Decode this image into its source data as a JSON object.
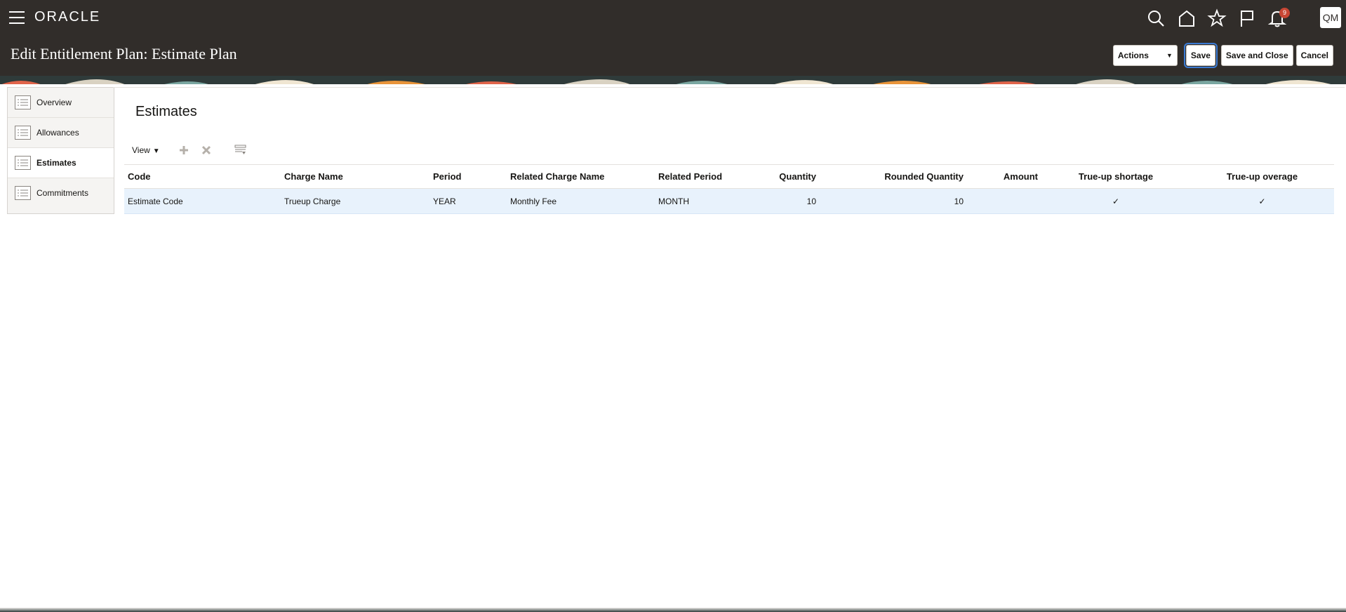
{
  "header": {
    "brand": "ORACLE",
    "notifications_count": "9",
    "user_initials": "QM",
    "page_title": "Edit Entitlement Plan: Estimate Plan",
    "actions_label": "Actions",
    "save_label": "Save",
    "save_close_label": "Save and Close",
    "cancel_label": "Cancel"
  },
  "sidebar": {
    "items": [
      {
        "label": "Overview",
        "active": false
      },
      {
        "label": "Allowances",
        "active": false
      },
      {
        "label": "Estimates",
        "active": true
      },
      {
        "label": "Commitments",
        "active": false
      }
    ]
  },
  "main": {
    "section_title": "Estimates",
    "toolbar": {
      "view_label": "View"
    },
    "table": {
      "columns": [
        "Code",
        "Charge Name",
        "Period",
        "Related Charge Name",
        "Related Period",
        "Quantity",
        "Rounded Quantity",
        "Amount",
        "True-up shortage",
        "True-up overage"
      ],
      "rows": [
        {
          "code": "Estimate Code",
          "charge_name": "Trueup Charge",
          "period": "YEAR",
          "related_charge_name": "Monthly Fee",
          "related_period": "MONTH",
          "quantity": "10",
          "rounded_quantity": "10",
          "amount": "",
          "trueup_shortage": "✓",
          "trueup_overage": "✓"
        }
      ]
    }
  },
  "colors": {
    "header_bg": "#312d2a",
    "selected_row": "#e8f2fc",
    "badge": "#c74634"
  }
}
